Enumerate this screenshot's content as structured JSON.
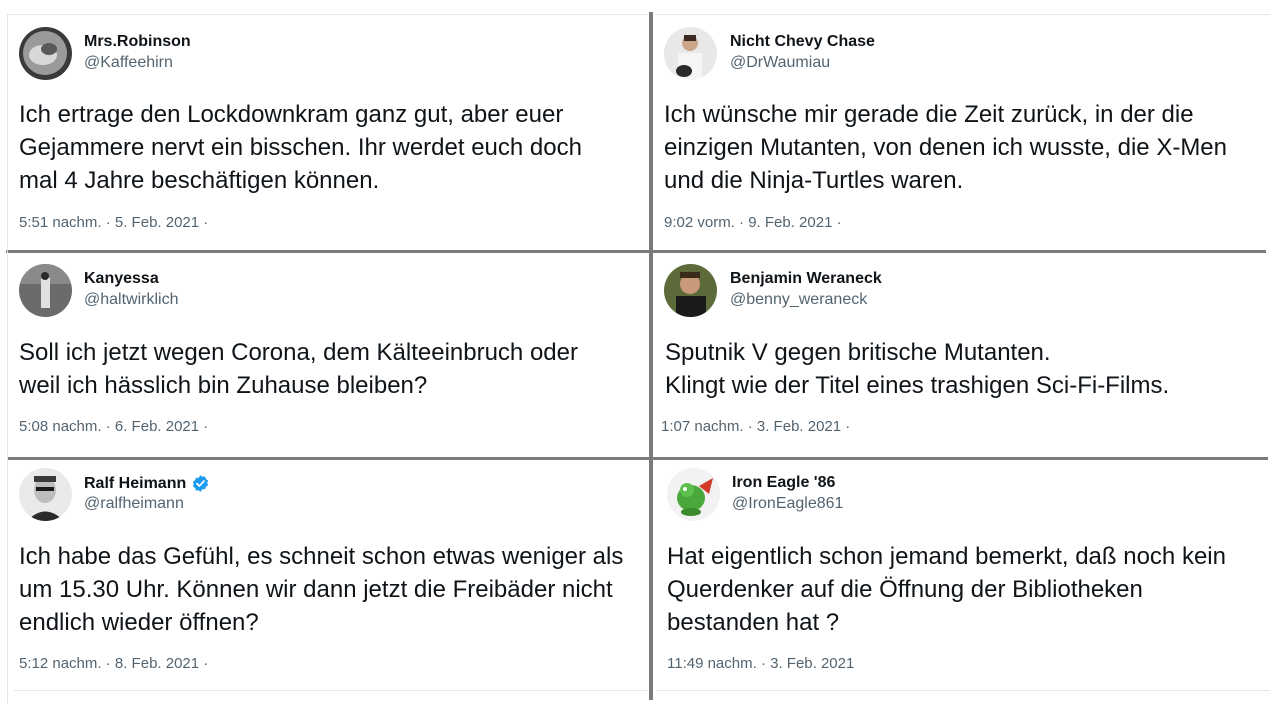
{
  "tweets": [
    {
      "name": "Mrs.Robinson",
      "handle": "@Kaffeehirn",
      "text": "Ich ertrage den Lockdownkram ganz gut, aber euer\nGejammere nervt ein bisschen. Ihr werdet euch doch\nmal 4 Jahre beschäftigen können.",
      "meta": "5:51 nachm. · 5. Feb. 2021 ·"
    },
    {
      "name": "Nicht Chevy Chase",
      "handle": "@DrWaumiau",
      "text": "Ich wünsche mir gerade die Zeit zurück, in der die\neinzigen Mutanten, von denen ich wusste, die X-Men\nund die Ninja-Turtles waren.",
      "meta": "9:02 vorm. · 9. Feb. 2021 ·"
    },
    {
      "name": "Kanyessa",
      "handle": "@haltwirklich",
      "text": "Soll ich jetzt wegen Corona, dem Kälteeinbruch oder\nweil ich hässlich bin Zuhause bleiben?",
      "meta": "5:08 nachm. · 6. Feb. 2021 ·"
    },
    {
      "name": "Benjamin Weraneck",
      "handle": "@benny_weraneck",
      "text": "Sputnik V gegen britische Mutanten.\nKlingt wie der Titel eines trashigen Sci-Fi-Films.",
      "meta": "1:07 nachm. · 3. Feb. 2021 ·"
    },
    {
      "name": "Ralf Heimann",
      "handle": "@ralfheimann",
      "text": "Ich habe das Gefühl, es schneit schon etwas weniger als\num 15.30 Uhr. Können wir dann jetzt die Freibäder nicht\nendlich wieder öffnen?",
      "meta": "5:12 nachm. · 8. Feb. 2021 ·",
      "verified": true
    },
    {
      "name": "Iron Eagle '86",
      "handle": "@IronEagle861",
      "text": "Hat eigentlich schon jemand bemerkt, daß noch kein\nQuerdenker auf die Öffnung der Bibliotheken\nbestanden hat ?",
      "meta": "11:49 nachm. · 3. Feb. 2021"
    }
  ],
  "colors": {
    "text": "#0f1419",
    "secondary": "#536471",
    "divider": "#7b7b7b",
    "verified": "#1d9bf0"
  },
  "icons": {
    "verified": "verified-badge-icon"
  }
}
